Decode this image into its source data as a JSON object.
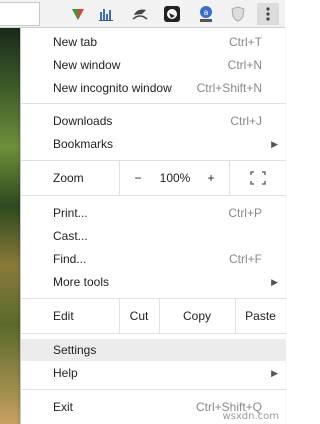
{
  "toolbar": {
    "icons": [
      "chart-triangle-extension-icon",
      "bar-chart-extension-icon",
      "weather-extension-icon",
      "panda-extension-icon",
      "user-badge-extension-icon",
      "shield-extension-icon",
      "chrome-menu-icon"
    ]
  },
  "menu": {
    "new_tab": {
      "label": "New tab",
      "shortcut": "Ctrl+T"
    },
    "new_window": {
      "label": "New window",
      "shortcut": "Ctrl+N"
    },
    "new_incognito": {
      "label": "New incognito window",
      "shortcut": "Ctrl+Shift+N"
    },
    "downloads": {
      "label": "Downloads",
      "shortcut": "Ctrl+J"
    },
    "bookmarks": {
      "label": "Bookmarks"
    },
    "zoom": {
      "label": "Zoom",
      "minus": "−",
      "value": "100%",
      "plus": "+"
    },
    "print": {
      "label": "Print...",
      "shortcut": "Ctrl+P"
    },
    "cast": {
      "label": "Cast..."
    },
    "find": {
      "label": "Find...",
      "shortcut": "Ctrl+F"
    },
    "more_tools": {
      "label": "More tools"
    },
    "edit": {
      "label": "Edit",
      "cut": "Cut",
      "copy": "Copy",
      "paste": "Paste"
    },
    "settings": {
      "label": "Settings"
    },
    "help": {
      "label": "Help"
    },
    "exit": {
      "label": "Exit",
      "shortcut": "Ctrl+Shift+Q"
    }
  },
  "watermark": "wsxdn.com"
}
